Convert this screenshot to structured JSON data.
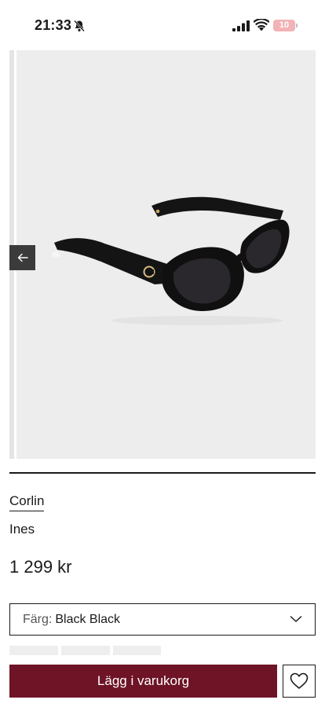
{
  "status_bar": {
    "time": "21:33",
    "battery": "10"
  },
  "gallery": {
    "image_alt": "Black sunglasses",
    "icons": [
      "bell-slash-icon",
      "signal-icon",
      "wifi-icon",
      "battery-icon",
      "arrow-left-icon",
      "chevron-down-icon",
      "heart-icon"
    ]
  },
  "product": {
    "brand": "Corlin",
    "name": "Ines",
    "price": "1 299 kr"
  },
  "color_select": {
    "label": "Färg:",
    "value": "Black Black"
  },
  "actions": {
    "add_to_cart": "Lägg i varukorg"
  },
  "colors": {
    "accent": "#6e1426",
    "battery": "#f3b2b6",
    "gallery_bg": "#ededed"
  }
}
